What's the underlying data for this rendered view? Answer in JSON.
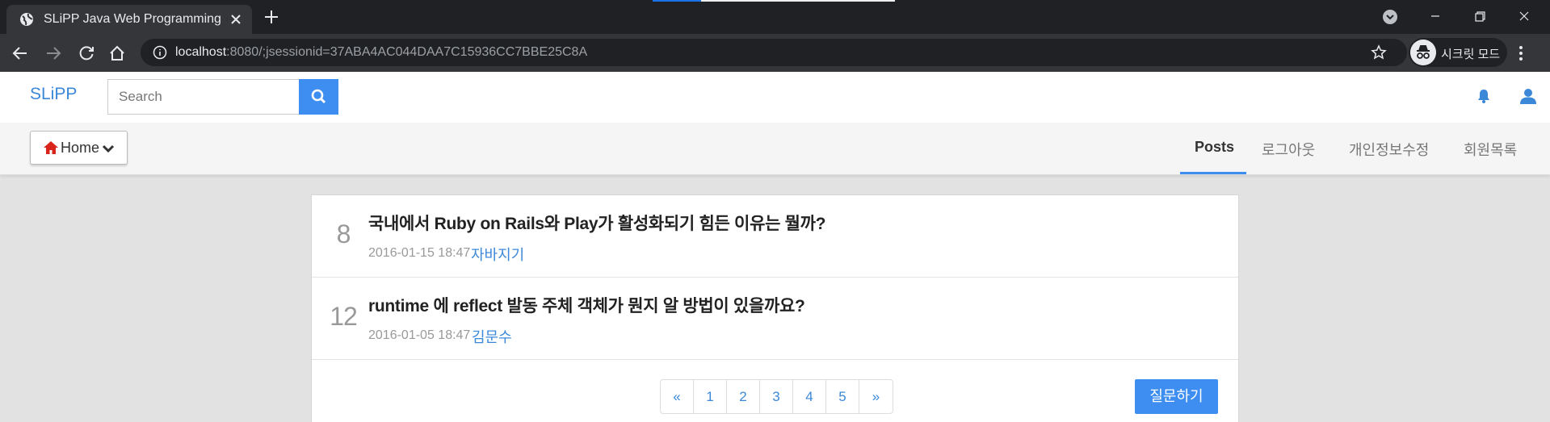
{
  "browser": {
    "tab": {
      "title": "SLiPP Java Web Programming"
    },
    "url": {
      "host": "localhost",
      "rest": ":8080/;jsessionid=37ABA4AC044DAA7C15936CC7BBE25C8A"
    },
    "incognito_label": "시크릿 모드"
  },
  "header": {
    "brand": "SLiPP",
    "search_placeholder": "Search"
  },
  "subnav": {
    "home_label": "Home",
    "items": [
      {
        "label": "Posts",
        "active": true
      },
      {
        "label": "로그아웃",
        "active": false
      },
      {
        "label": "개인정보수정",
        "active": false
      },
      {
        "label": "회원목록",
        "active": false
      }
    ]
  },
  "questions": [
    {
      "count": "8",
      "title": "국내에서 Ruby on Rails와 Play가 활성화되기 힘든 이유는 뭘까?",
      "date": "2016-01-15 18:47",
      "author": "자바지기"
    },
    {
      "count": "12",
      "title": "runtime 에 reflect 발동 주체 객체가 뭔지 알 방법이 있을까요?",
      "date": "2016-01-05 18:47",
      "author": "김문수"
    }
  ],
  "pagination": {
    "prev": "«",
    "pages": [
      "1",
      "2",
      "3",
      "4",
      "5"
    ],
    "next": "»"
  },
  "ask_button": "질문하기",
  "colors": {
    "accent": "#3d8ef0",
    "link": "#3b88d9",
    "home_icon": "#d9241b"
  }
}
